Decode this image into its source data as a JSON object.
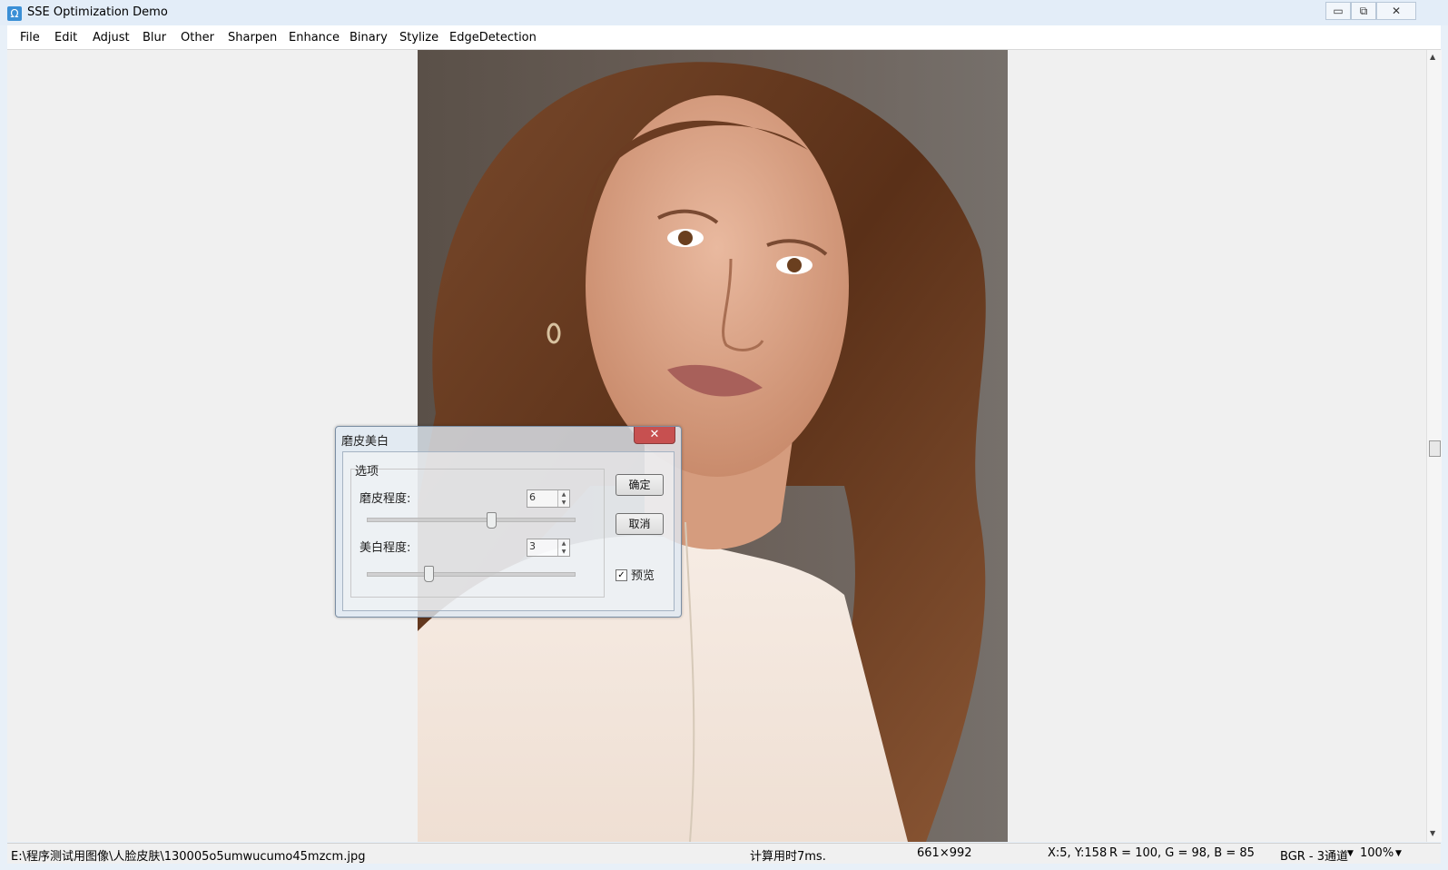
{
  "window": {
    "title": "SSE Optimization Demo",
    "icon_glyph": "Ω",
    "controls": {
      "minimize": "▭",
      "maximize": "⧉",
      "close": "✕"
    }
  },
  "menu": [
    "File",
    "Edit",
    "Adjust",
    "Blur",
    "Other",
    "Sharpen",
    "Enhance",
    "Binary",
    "Stylize",
    "EdgeDetection"
  ],
  "dialog": {
    "title": "磨皮美白",
    "close_glyph": "✕",
    "group_label": "选项",
    "smooth_label": "磨皮程度:",
    "smooth_value": "6",
    "smooth_slider_level": 0.6,
    "whiten_label": "美白程度:",
    "whiten_value": "3",
    "whiten_slider_level": 0.3,
    "ok_label": "确定",
    "cancel_label": "取消",
    "preview_label": "预览",
    "preview_checked": true
  },
  "status": {
    "path": "E:\\程序测试用图像\\人脸皮肤\\130005o5umwucumo45mzcm.jpg",
    "time": "计算用时7ms.",
    "size": "661×992",
    "coords": "X:5, Y:158",
    "rgb": "R = 100, G = 98, B = 85",
    "format": "BGR - 3通道",
    "zoom": "100%"
  },
  "icons": {
    "app": "omega-icon",
    "checkbox": "check-icon",
    "dropdown": "chevron-down-icon"
  }
}
